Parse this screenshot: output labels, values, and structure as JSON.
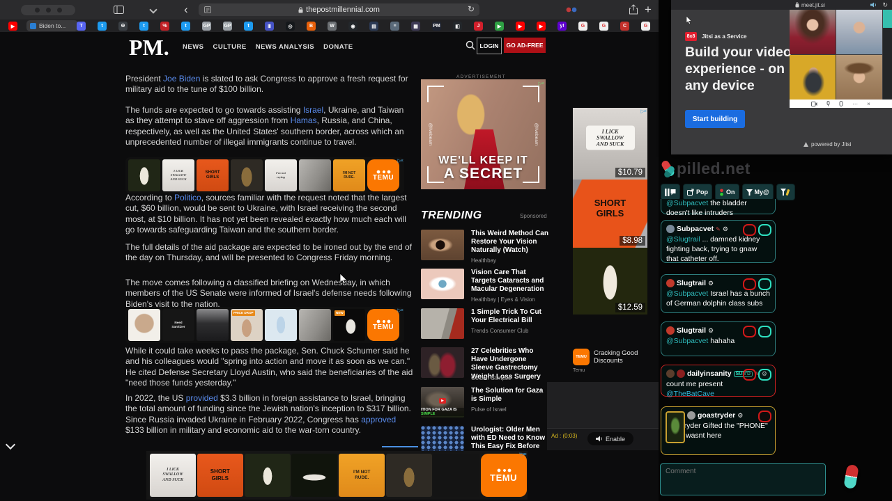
{
  "browser": {
    "url": "thepostmillennial.com",
    "tab_title": "Biden to...",
    "new_tab_label": "+",
    "favicons": [
      {
        "c": "#ff0000",
        "g": "▶"
      },
      {
        "c": "#5865f2",
        "g": "T"
      },
      {
        "c": "#1d9bf0",
        "g": "t"
      },
      {
        "c": "#3a3f44",
        "g": "Θ"
      },
      {
        "c": "#1d9bf0",
        "g": "t"
      },
      {
        "c": "#c22127",
        "g": "%"
      },
      {
        "c": "#1d9bf0",
        "g": "t"
      },
      {
        "c": "#9aa0a6",
        "g": "GP"
      },
      {
        "c": "#9aa0a6",
        "g": "GP"
      },
      {
        "c": "#1d9bf0",
        "g": "t"
      },
      {
        "c": "#4653c5",
        "g": "Ⅲ"
      },
      {
        "c": "#15181b",
        "g": "◎"
      },
      {
        "c": "#e8600a",
        "g": "B"
      },
      {
        "c": "#6b6f73",
        "g": "W"
      },
      {
        "c": "#23272b",
        "g": "◉"
      },
      {
        "c": "#2b3a55",
        "g": "▤"
      },
      {
        "c": "#5a6a7a",
        "g": "≡"
      },
      {
        "c": "#3e3a56",
        "g": "▦"
      },
      {
        "c": "#1f2430",
        "g": "PM"
      },
      {
        "c": "#23272b",
        "g": "◧"
      },
      {
        "c": "#d21f2b",
        "g": "J"
      },
      {
        "c": "#2ea043",
        "g": "▶"
      },
      {
        "c": "#ff0000",
        "g": "▶"
      },
      {
        "c": "#ff0000",
        "g": "▶"
      },
      {
        "c": "#5f01d1",
        "g": "y!"
      },
      {
        "c": "#f1f1f1",
        "g": "G"
      },
      {
        "c": "#f1f1f1",
        "g": "G"
      },
      {
        "c": "#c4302b",
        "g": "C"
      },
      {
        "c": "#f1f1f1",
        "g": "G"
      }
    ]
  },
  "masthead": {
    "logo": "PM.",
    "nav": [
      "NEWS",
      "CULTURE",
      "NEWS ANALYSIS",
      "DONATE"
    ],
    "login": "LOGIN",
    "go_ad_free": "GO AD-FREE"
  },
  "article": {
    "paragraphs": [
      [
        {
          "t": "President "
        },
        {
          "t": "Joe Biden",
          "l": 1
        },
        {
          "t": " is slated to ask Congress to approve a fresh request for military aid to the tune of $100 billion."
        }
      ],
      [
        {
          "t": "The funds are expected to go towards assisting "
        },
        {
          "t": "Israel",
          "l": 1
        },
        {
          "t": ", Ukraine, and Taiwan as they attempt to stave off aggression from "
        },
        {
          "t": "Hamas",
          "l": 1
        },
        {
          "t": ", Russia, and China, respectively, as well as the United States' southern border, across which an unprecedented number of illegal immigrants continue to travel."
        }
      ],
      [
        {
          "t": "According to "
        },
        {
          "t": "Politico",
          "l": 1
        },
        {
          "t": ", sources familiar with the request noted that the largest cut, $60 billion, would be sent to Ukraine, with Israel receiving the second most, at $10 billion. It has not yet been revealed exactly how much each will go towards safeguarding Taiwan and the southern border."
        }
      ],
      [
        {
          "t": "The full details of the aid package are expected to be ironed out by the end of the day on Thursday, and will be presented to Congress Friday morning."
        }
      ],
      [
        {
          "t": "The move comes following a classified briefing on Wednesday, in which members of the US Senate were informed of Israel's defense needs following Biden's visit to the nation."
        }
      ],
      [
        {
          "t": "While it could take weeks to pass the package, Sen. Chuck Schumer said he and his colleagues would \"spring into action and move it as soon as we can.\" He cited Defense Secretary Lloyd Austin, who said the beneficiaries of the aid \"need those funds yesterday.\""
        }
      ],
      [
        {
          "t": "In 2022, the US "
        },
        {
          "t": "provided",
          "l": 1
        },
        {
          "t": " $3.3 billion in foreign assistance to Israel, bringing the total amount of funding since the Jewish nation's inception to $317 billion. Since Russia invaded Ukraine in February 2022, Congress has "
        },
        {
          "t": "approved",
          "l": 1
        },
        {
          "t": " $133 billion in military and economic aid to the war-torn country."
        }
      ]
    ]
  },
  "ad_strips": {
    "brand": "TEMU",
    "strip1": [
      {
        "k": "lace-dark"
      },
      {
        "k": "tee-white",
        "t": "I LICK\nSWALLOW\nAND SUCK"
      },
      {
        "k": "tee-orange",
        "t": "SHORT\nGIRLS"
      },
      {
        "k": "bodysuit"
      },
      {
        "k": "tee-white",
        "t": "I'm not\ncrying"
      },
      {
        "k": "photo-grey"
      },
      {
        "k": "tee-amber",
        "t": "I'M NOT\nRUDE."
      },
      {
        "k": "temu"
      }
    ],
    "strip2": [
      {
        "k": "photo-white"
      },
      {
        "k": "tee-black",
        "t": "Need\nSanitizer"
      },
      {
        "k": "gadget"
      },
      {
        "k": "price-drop",
        "t": "PRICE DROP"
      },
      {
        "k": "photo-blue"
      },
      {
        "k": "photo-grey"
      },
      {
        "k": "dragon",
        "t": "NEW"
      },
      {
        "k": "temu"
      }
    ],
    "banner": [
      {
        "k": "tee-white",
        "t": "I LICK\nSWALLOW\nAND SUCK"
      },
      {
        "k": "tee-orange",
        "t": "SHORT\nGIRLS"
      },
      {
        "k": "lace-dark"
      },
      {
        "k": "shuttle"
      },
      {
        "k": "tee-amber",
        "t": "I'M NOT\nRUDE."
      },
      {
        "k": "bodysuit"
      },
      {
        "k": "dark"
      },
      {
        "k": "temu"
      }
    ]
  },
  "center_ad": {
    "label": "ADVERTISEMENT",
    "line1": "WE'LL KEEP IT",
    "line2": "A SECRET",
    "watermark": "@livebeam"
  },
  "trending": {
    "title": "TRENDING",
    "sponsored": "Sponsored",
    "items": [
      {
        "title": "This Weird Method Can Restore Your Vision Naturally (Watch)",
        "source": "Healthbay",
        "thumb": "eye-photo"
      },
      {
        "title": "Vision Care That Targets Cataracts and Macular Degeneration",
        "source": "Healthbay | Eyes & Vision",
        "thumb": "eye-art"
      },
      {
        "title": "1 Simple Trick To Cut Your Electrical Bill",
        "source": "Trends Consumer Club",
        "thumb": "outlet"
      },
      {
        "title": "27 Celebrities Who Have Undergone Sleeve Gastrectomy Weight Loss Surgery",
        "source": "Golden Glimpse",
        "thumb": "couple"
      },
      {
        "title": "The Solution for Gaza is Simple",
        "source": "Pulse of Israel",
        "thumb": "explosion",
        "caption_white": "ITION FOR GAZA IS ",
        "caption_green": "SIMPLE"
      },
      {
        "title": "Urologist: Older Men with ED Need to Know This Easy Fix Before It's Too Late",
        "source": "",
        "thumb": "pills"
      }
    ]
  },
  "product_ads": {
    "items": [
      {
        "price": "$10.79",
        "kind": "lick-tee",
        "text": "I LICK\nSWALLOW\nAND SUCK"
      },
      {
        "price": "$8.98",
        "kind": "short-girls",
        "text": "SHORT\nGIRLS"
      },
      {
        "price": "$12.59",
        "kind": "lace-outfit",
        "text": ""
      }
    ],
    "footer_title": "Cracking Good Discounts",
    "footer_brand": "Temu",
    "temu_mini": "TEMU"
  },
  "video_ad": {
    "label": "Ad : (0:03)",
    "button": "Enable"
  },
  "chat": {
    "logo": "pilled.net",
    "tools": [
      {
        "label": "",
        "icon": "pause-bubble"
      },
      {
        "label": "Pop",
        "icon": "popout"
      },
      {
        "label": "On",
        "icon": "status"
      },
      {
        "label": "My@",
        "icon": "funnel"
      },
      {
        "label": "",
        "icon": "funnel-pencil"
      }
    ],
    "messages": [
      {
        "cut": true,
        "border": "teal",
        "body": [
          {
            "t": "@Subpacvet",
            "m": 1
          },
          {
            "t": " the bladder doesn't like intruders"
          }
        ]
      },
      {
        "user": "Subpacvet",
        "pencil": true,
        "gear": true,
        "border": "teal",
        "avatar": "#7a8a99",
        "body": [
          {
            "t": "@Slugtrail",
            "m": 1
          },
          {
            "t": " ... damned kidney fighting back, trying to gnaw that catheter off."
          }
        ],
        "btns": [
          "red",
          "teal"
        ]
      },
      {
        "user": "Slugtrail",
        "gear": true,
        "border": "teal",
        "avatar": "#c0392b",
        "body": [
          {
            "t": "@Subpacvet",
            "m": 1
          },
          {
            "t": " Israel has a bunch of German dolphin class subs"
          }
        ],
        "btns": [
          "red",
          "teal"
        ]
      },
      {
        "user": "Slugtrail",
        "gear": true,
        "border": "teal",
        "avatar": "#c0392b",
        "body": [
          {
            "t": "@Subpacvet",
            "m": 1
          },
          {
            "t": " hahaha"
          }
        ],
        "btns": [
          "red",
          "teal"
        ]
      },
      {
        "user": "dailyinsanity",
        "badge": "SUB'D",
        "pencil": true,
        "gear": true,
        "border": "red",
        "avatar": "#5a3d2c",
        "avatar2": "#8a1f1f",
        "body": [
          {
            "t": "count me present "
          },
          {
            "t": "@TheBatCave",
            "m": 2
          }
        ],
        "btns": [
          "red",
          "teal"
        ]
      },
      {
        "user": "goastryder",
        "gear": true,
        "border": "gold",
        "avatar": "#9a9a9a",
        "big_avatar": true,
        "body": [
          {
            "t": "goastryder Gifted the \"PHONE\" stfu. i wasnt here"
          }
        ],
        "btns": [
          "red"
        ]
      }
    ],
    "comment_placeholder": "Comment"
  },
  "jitsi": {
    "url": "meet.jit.si",
    "brand": "8x8",
    "service": "Jitsi as a Service",
    "heading": "Build your video experience - on any device",
    "cta": "Start building",
    "powered": "powered by Jitsi"
  },
  "colors": {
    "accent_red": "#ae1016",
    "temu_orange": "#fb7701",
    "chat_teal": "#2e7d7d",
    "mention_teal": "#2fb9b9",
    "link_blue": "#5b8def",
    "jitsi_blue": "#1a6ce0"
  }
}
